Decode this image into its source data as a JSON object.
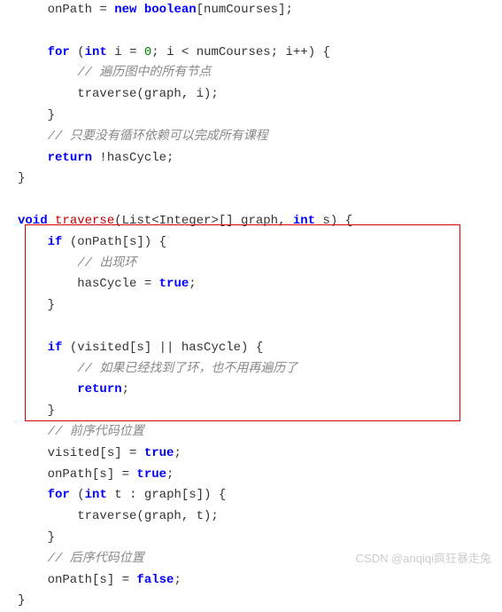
{
  "code": {
    "l01a": "    onPath = ",
    "l01b": "new",
    "l01c": " ",
    "l01d": "boolean",
    "l01e": "[numCourses];",
    "l02": "",
    "l03a": "    ",
    "l03b": "for",
    "l03c": " (",
    "l03d": "int",
    "l03e": " i = ",
    "l03f": "0",
    "l03g": "; i < numCourses; i++) {",
    "l04": "        // 遍历图中的所有节点",
    "l05": "        traverse(graph, i);",
    "l06": "    }",
    "l07": "    // 只要没有循环依赖可以完成所有课程",
    "l08a": "    ",
    "l08b": "return",
    "l08c": " !hasCycle;",
    "l09": "}",
    "l10": "",
    "l11a": "void",
    "l11b": " ",
    "l11c": "traverse",
    "l11d": "(List<Integer>[] graph, ",
    "l11e": "int",
    "l11f": " s) {",
    "l12a": "    ",
    "l12b": "if",
    "l12c": " (onPath[s]) {",
    "l13": "        // 出现环",
    "l14a": "        hasCycle = ",
    "l14b": "true",
    "l14c": ";",
    "l15": "    }",
    "l16": "",
    "l17a": "    ",
    "l17b": "if",
    "l17c": " (visited[s] || hasCycle) {",
    "l18": "        // 如果已经找到了环，也不用再遍历了",
    "l19a": "        ",
    "l19b": "return",
    "l19c": ";",
    "l20": "    }",
    "l21": "    // 前序代码位置",
    "l22a": "    visited[s] = ",
    "l22b": "true",
    "l22c": ";",
    "l23a": "    onPath[s] = ",
    "l23b": "true",
    "l23c": ";",
    "l24a": "    ",
    "l24b": "for",
    "l24c": " (",
    "l24d": "int",
    "l24e": " t : graph[s]) {",
    "l25": "        traverse(graph, t);",
    "l26": "    }",
    "l27": "    // 后序代码位置",
    "l28a": "    onPath[s] = ",
    "l28b": "false",
    "l28c": ";",
    "l29": "}"
  },
  "watermark": "CSDN @anqiqi疯狂暴走兔"
}
